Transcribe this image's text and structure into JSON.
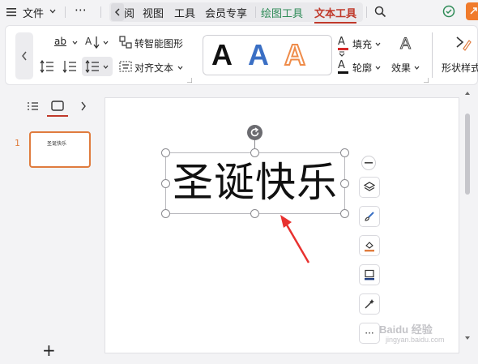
{
  "menubar": {
    "file_label": "文件",
    "more_label": "⋯",
    "tabs": [
      {
        "label": "阅"
      },
      {
        "label": "视图"
      },
      {
        "label": "工具"
      },
      {
        "label": "会员专享"
      },
      {
        "label": "绘图工具"
      },
      {
        "label": "文本工具"
      }
    ]
  },
  "ribbon": {
    "convert_smartart_label": "转智能图形",
    "align_text_label": "对齐文本",
    "text_styles": [
      {
        "glyph": "A",
        "style": "black"
      },
      {
        "glyph": "A",
        "style": "blue"
      },
      {
        "glyph": "A",
        "style": "orange-outline"
      }
    ],
    "fill_label": "填充",
    "outline_label": "轮廓",
    "effect_label": "效果",
    "shape_style_label": "形状样式",
    "colors": {
      "fill": "#d62b2b",
      "outline": "#111111",
      "accent": "#c0392b",
      "green": "#2e8b57"
    }
  },
  "leftpanel": {
    "slide_number": "1",
    "thumb_text": "圣诞快乐",
    "add_label": "+"
  },
  "canvas": {
    "text_content": "圣诞快乐"
  },
  "watermark": {
    "line1": "Baidu 经验",
    "line2": "jingyan.baidu.com"
  }
}
